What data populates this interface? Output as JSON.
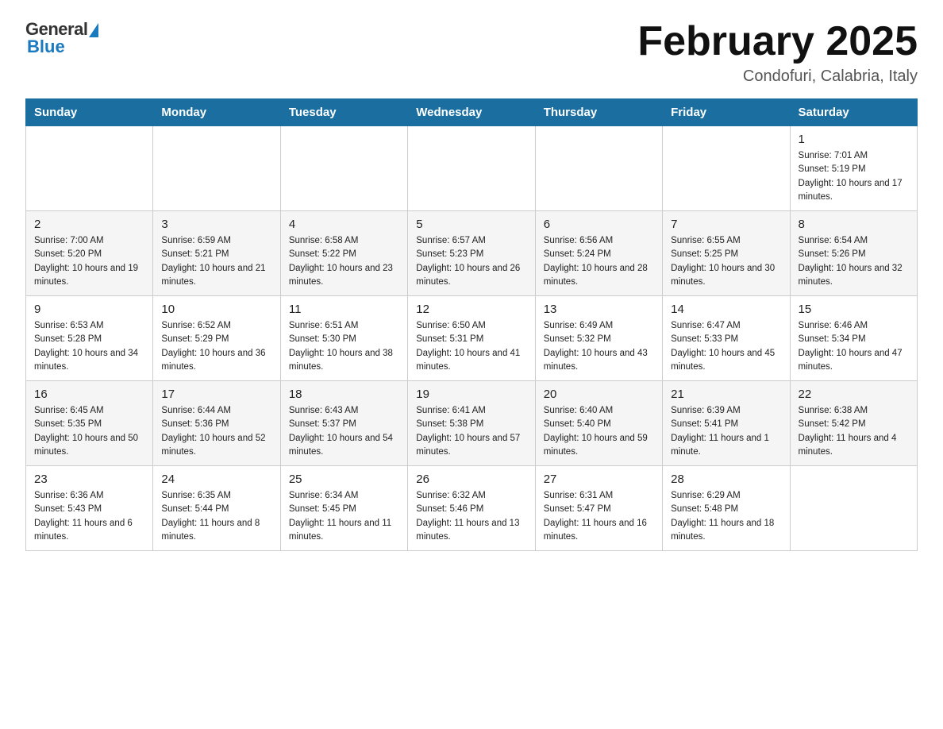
{
  "header": {
    "logo": {
      "general": "General",
      "blue": "Blue"
    },
    "title": "February 2025",
    "subtitle": "Condofuri, Calabria, Italy"
  },
  "days_of_week": [
    "Sunday",
    "Monday",
    "Tuesday",
    "Wednesday",
    "Thursday",
    "Friday",
    "Saturday"
  ],
  "weeks": [
    {
      "days": [
        {
          "num": "",
          "info": ""
        },
        {
          "num": "",
          "info": ""
        },
        {
          "num": "",
          "info": ""
        },
        {
          "num": "",
          "info": ""
        },
        {
          "num": "",
          "info": ""
        },
        {
          "num": "",
          "info": ""
        },
        {
          "num": "1",
          "info": "Sunrise: 7:01 AM\nSunset: 5:19 PM\nDaylight: 10 hours and 17 minutes."
        }
      ]
    },
    {
      "days": [
        {
          "num": "2",
          "info": "Sunrise: 7:00 AM\nSunset: 5:20 PM\nDaylight: 10 hours and 19 minutes."
        },
        {
          "num": "3",
          "info": "Sunrise: 6:59 AM\nSunset: 5:21 PM\nDaylight: 10 hours and 21 minutes."
        },
        {
          "num": "4",
          "info": "Sunrise: 6:58 AM\nSunset: 5:22 PM\nDaylight: 10 hours and 23 minutes."
        },
        {
          "num": "5",
          "info": "Sunrise: 6:57 AM\nSunset: 5:23 PM\nDaylight: 10 hours and 26 minutes."
        },
        {
          "num": "6",
          "info": "Sunrise: 6:56 AM\nSunset: 5:24 PM\nDaylight: 10 hours and 28 minutes."
        },
        {
          "num": "7",
          "info": "Sunrise: 6:55 AM\nSunset: 5:25 PM\nDaylight: 10 hours and 30 minutes."
        },
        {
          "num": "8",
          "info": "Sunrise: 6:54 AM\nSunset: 5:26 PM\nDaylight: 10 hours and 32 minutes."
        }
      ]
    },
    {
      "days": [
        {
          "num": "9",
          "info": "Sunrise: 6:53 AM\nSunset: 5:28 PM\nDaylight: 10 hours and 34 minutes."
        },
        {
          "num": "10",
          "info": "Sunrise: 6:52 AM\nSunset: 5:29 PM\nDaylight: 10 hours and 36 minutes."
        },
        {
          "num": "11",
          "info": "Sunrise: 6:51 AM\nSunset: 5:30 PM\nDaylight: 10 hours and 38 minutes."
        },
        {
          "num": "12",
          "info": "Sunrise: 6:50 AM\nSunset: 5:31 PM\nDaylight: 10 hours and 41 minutes."
        },
        {
          "num": "13",
          "info": "Sunrise: 6:49 AM\nSunset: 5:32 PM\nDaylight: 10 hours and 43 minutes."
        },
        {
          "num": "14",
          "info": "Sunrise: 6:47 AM\nSunset: 5:33 PM\nDaylight: 10 hours and 45 minutes."
        },
        {
          "num": "15",
          "info": "Sunrise: 6:46 AM\nSunset: 5:34 PM\nDaylight: 10 hours and 47 minutes."
        }
      ]
    },
    {
      "days": [
        {
          "num": "16",
          "info": "Sunrise: 6:45 AM\nSunset: 5:35 PM\nDaylight: 10 hours and 50 minutes."
        },
        {
          "num": "17",
          "info": "Sunrise: 6:44 AM\nSunset: 5:36 PM\nDaylight: 10 hours and 52 minutes."
        },
        {
          "num": "18",
          "info": "Sunrise: 6:43 AM\nSunset: 5:37 PM\nDaylight: 10 hours and 54 minutes."
        },
        {
          "num": "19",
          "info": "Sunrise: 6:41 AM\nSunset: 5:38 PM\nDaylight: 10 hours and 57 minutes."
        },
        {
          "num": "20",
          "info": "Sunrise: 6:40 AM\nSunset: 5:40 PM\nDaylight: 10 hours and 59 minutes."
        },
        {
          "num": "21",
          "info": "Sunrise: 6:39 AM\nSunset: 5:41 PM\nDaylight: 11 hours and 1 minute."
        },
        {
          "num": "22",
          "info": "Sunrise: 6:38 AM\nSunset: 5:42 PM\nDaylight: 11 hours and 4 minutes."
        }
      ]
    },
    {
      "days": [
        {
          "num": "23",
          "info": "Sunrise: 6:36 AM\nSunset: 5:43 PM\nDaylight: 11 hours and 6 minutes."
        },
        {
          "num": "24",
          "info": "Sunrise: 6:35 AM\nSunset: 5:44 PM\nDaylight: 11 hours and 8 minutes."
        },
        {
          "num": "25",
          "info": "Sunrise: 6:34 AM\nSunset: 5:45 PM\nDaylight: 11 hours and 11 minutes."
        },
        {
          "num": "26",
          "info": "Sunrise: 6:32 AM\nSunset: 5:46 PM\nDaylight: 11 hours and 13 minutes."
        },
        {
          "num": "27",
          "info": "Sunrise: 6:31 AM\nSunset: 5:47 PM\nDaylight: 11 hours and 16 minutes."
        },
        {
          "num": "28",
          "info": "Sunrise: 6:29 AM\nSunset: 5:48 PM\nDaylight: 11 hours and 18 minutes."
        },
        {
          "num": "",
          "info": ""
        }
      ]
    }
  ]
}
